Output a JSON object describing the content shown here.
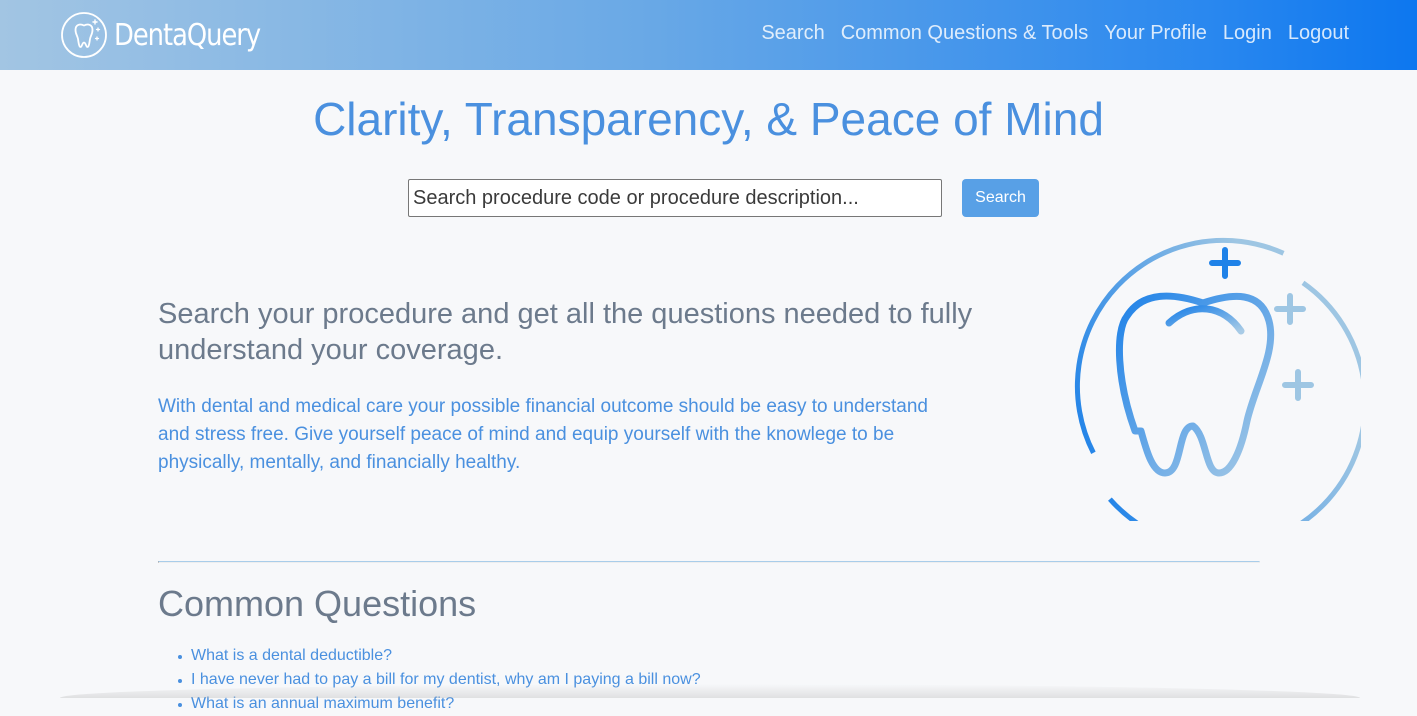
{
  "brand": {
    "name": "DentaQuery",
    "logo_icon": "tooth-sparkle-icon"
  },
  "nav": {
    "items": [
      {
        "label": "Search"
      },
      {
        "label": "Common Questions & Tools"
      },
      {
        "label": "Your Profile"
      },
      {
        "label": "Login"
      },
      {
        "label": "Logout"
      }
    ]
  },
  "hero": {
    "title": "Clarity, Transparency, & Peace of Mind",
    "search_placeholder": "Search procedure code or procedure description...",
    "search_value": "",
    "search_button": "Search",
    "lead": "Search your procedure and get all the questions needed to fully understand your coverage.",
    "body": "With dental and medical care your possible financial outcome should be easy to understand and stress free. Give yourself peace of mind and equip yourself with the knowlege to be physically, mentally, and financially healthy.",
    "illustration_icon": "tooth-plus-icon"
  },
  "common_questions": {
    "title": "Common Questions",
    "items": [
      {
        "label": "What is a dental deductible?"
      },
      {
        "label": "I have never had to pay a bill for my dentist, why am I paying a bill now?"
      },
      {
        "label": "What is an annual maximum benefit?"
      }
    ]
  },
  "colors": {
    "primary": "#4a90df",
    "navbar_start": "#a2c5e3",
    "navbar_end": "#0d77ef",
    "muted_text": "#6c7a8c",
    "button": "#58a0e6",
    "background": "#f7f8fa"
  }
}
